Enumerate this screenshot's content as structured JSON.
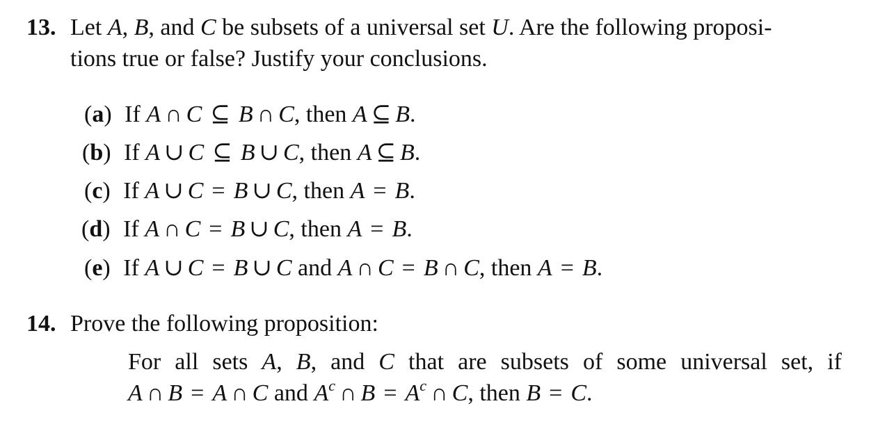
{
  "problems": [
    {
      "number": "13.",
      "intro_line1": {
        "t1": "Let ",
        "A": "A",
        "t2": ", ",
        "B": "B",
        "t3": ", and ",
        "C": "C",
        "t4": " be subsets of a universal set ",
        "U": "U",
        "t5": ".  Are the following proposi-"
      },
      "intro_line2": "tions true or false? Justify your conclusions.",
      "parts": [
        {
          "label_open": "(",
          "label": "a",
          "label_close": ")",
          "if": "If ",
          "lhs_a": "A",
          "lhs_op": "∩",
          "lhs_b": "C",
          "rel": "⊆",
          "rhs_a": "B",
          "rhs_op": "∩",
          "rhs_b": "C",
          "mid": ", then ",
          "c_a": "A",
          "c_rel": "⊆",
          "c_b": "B",
          "end": "."
        },
        {
          "label_open": "(",
          "label": "b",
          "label_close": ")",
          "if": "If ",
          "lhs_a": "A",
          "lhs_op": "∪",
          "lhs_b": "C",
          "rel": "⊆",
          "rhs_a": "B",
          "rhs_op": "∪",
          "rhs_b": "C",
          "mid": ", then ",
          "c_a": "A",
          "c_rel": "⊆",
          "c_b": "B",
          "end": "."
        },
        {
          "label_open": "(",
          "label": "c",
          "label_close": ")",
          "if": "If ",
          "lhs_a": "A",
          "lhs_op": "∪",
          "lhs_b": "C",
          "rel": "=",
          "rhs_a": "B",
          "rhs_op": "∪",
          "rhs_b": "C",
          "mid": ", then ",
          "c_a": "A",
          "c_rel": "=",
          "c_b": "B",
          "end": "."
        },
        {
          "label_open": "(",
          "label": "d",
          "label_close": ")",
          "if": "If ",
          "lhs_a": "A",
          "lhs_op": "∩",
          "lhs_b": "C",
          "rel": "=",
          "rhs_a": "B",
          "rhs_op": "∪",
          "rhs_b": "C",
          "mid": ", then ",
          "c_a": "A",
          "c_rel": "=",
          "c_b": "B",
          "end": "."
        },
        {
          "label_open": "(",
          "label": "e",
          "label_close": ")",
          "if": "If ",
          "lhs_a": "A",
          "lhs_op": "∪",
          "lhs_b": "C",
          "rel": "=",
          "rhs_a": "B",
          "rhs_op": "∪",
          "rhs_b": "C",
          "and": " and ",
          "lhs2_a": "A",
          "lhs2_op": "∩",
          "lhs2_b": "C",
          "rel2": "=",
          "rhs2_a": "B",
          "rhs2_op": "∩",
          "rhs2_b": "C",
          "mid": ", then ",
          "c_a": "A",
          "c_rel": "=",
          "c_b": "B",
          "end": "."
        }
      ]
    },
    {
      "number": "14.",
      "intro": "Prove the following proposition:",
      "statement_line1": {
        "t1": "For all sets ",
        "A": "A",
        "t2": ", ",
        "B": "B",
        "t3": ", and ",
        "C": "C",
        "t4": " that are subsets of some universal set, if"
      },
      "statement_line2": {
        "a1": "A",
        "op1": "∩",
        "b1": "B",
        "rel1": "=",
        "a2": "A",
        "op2": "∩",
        "c2": "C",
        "and": " and ",
        "a3": "A",
        "sup3": "c",
        "op3": "∩",
        "b3": "B",
        "rel2": "=",
        "a4": "A",
        "sup4": "c",
        "op4": "∩",
        "c4": "C",
        "mid": ", then ",
        "b5": "B",
        "rel3": "=",
        "c5": "C",
        "end": "."
      }
    }
  ]
}
